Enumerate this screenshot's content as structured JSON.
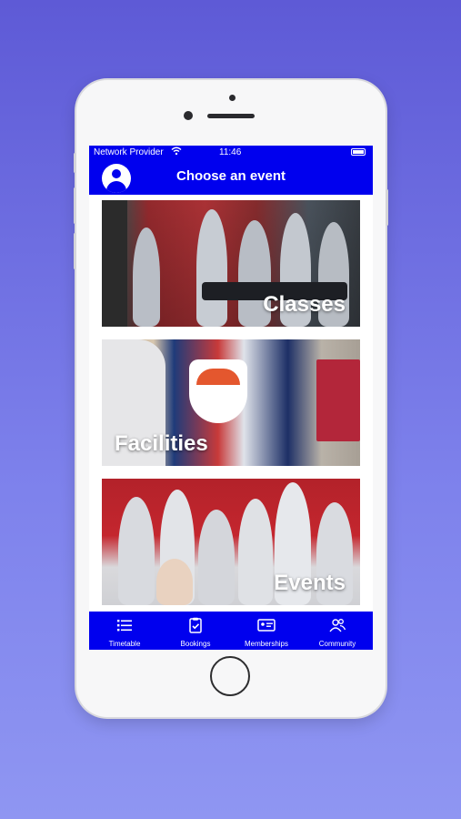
{
  "status_bar": {
    "carrier": "Network Provider",
    "time": "11:46"
  },
  "header": {
    "title": "Choose an event"
  },
  "cards": [
    {
      "label": "Classes"
    },
    {
      "label": "Facilities"
    },
    {
      "label": "Events"
    }
  ],
  "tabs": [
    {
      "label": "Timetable",
      "icon": "list-icon"
    },
    {
      "label": "Bookings",
      "icon": "clipboard-check-icon"
    },
    {
      "label": "Memberships",
      "icon": "member-card-icon"
    },
    {
      "label": "Community",
      "icon": "people-icon"
    }
  ],
  "colors": {
    "background": "#6a6ae0",
    "accent": "#0000ee"
  }
}
